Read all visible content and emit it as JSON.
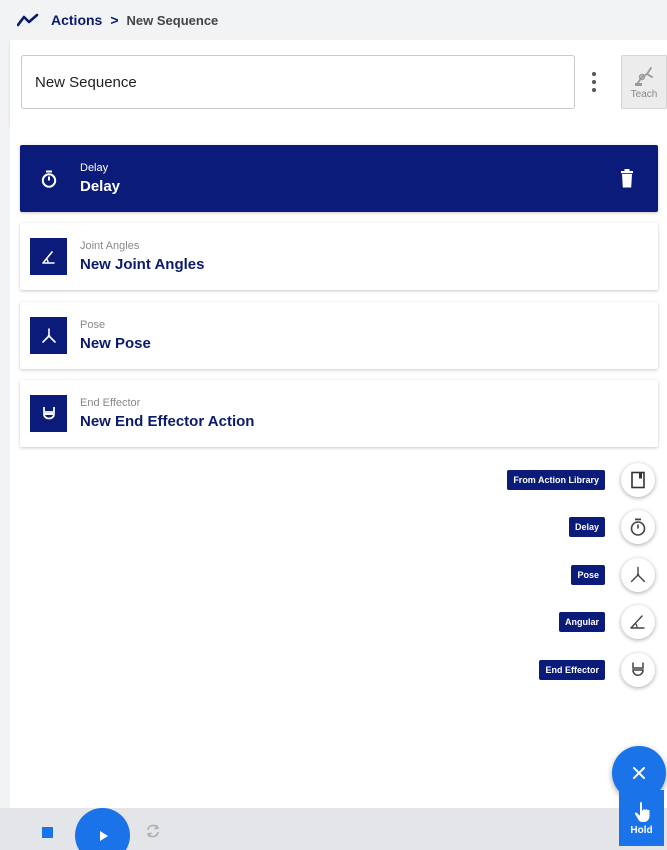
{
  "breadcrumb": {
    "root": "Actions",
    "separator": ">",
    "current": "New Sequence"
  },
  "header": {
    "name_value": "New Sequence",
    "teach_label": "Teach"
  },
  "steps": [
    {
      "type": "Delay",
      "title": "Delay",
      "icon": "timer-icon",
      "selected": true
    },
    {
      "type": "Joint Angles",
      "title": "New Joint Angles",
      "icon": "angle-icon",
      "selected": false
    },
    {
      "type": "Pose",
      "title": "New Pose",
      "icon": "pose-icon",
      "selected": false
    },
    {
      "type": "End Effector",
      "title": "New End Effector Action",
      "icon": "gripper-icon",
      "selected": false
    }
  ],
  "fab_menu": [
    {
      "label": "From Action Library",
      "icon": "library-icon"
    },
    {
      "label": "Delay",
      "icon": "timer-icon"
    },
    {
      "label": "Pose",
      "icon": "pose-icon"
    },
    {
      "label": "Angular",
      "icon": "angle-icon"
    },
    {
      "label": "End Effector",
      "icon": "gripper-icon"
    }
  ],
  "bottombar": {
    "hold_label": "Hold"
  },
  "colors": {
    "navy": "#0a1b7a",
    "accent_blue": "#1a73e8",
    "background": "#f2f3f5"
  }
}
